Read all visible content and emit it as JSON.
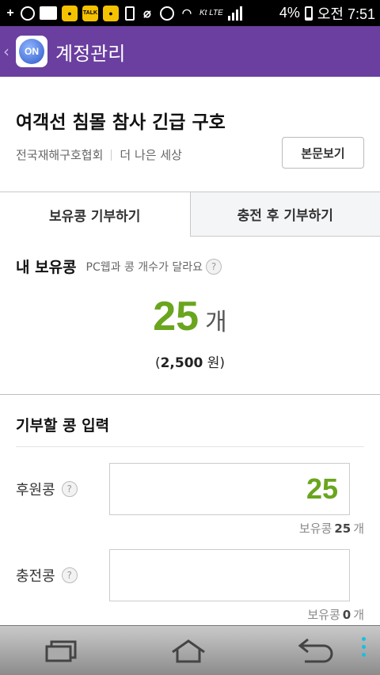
{
  "statusbar": {
    "battery": "4%",
    "time": "오전 7:51",
    "carrier": "Kt LTE",
    "icons": [
      "plus-icon",
      "alarm-icon",
      "gallery-icon",
      "kakao-icon",
      "kakaotalk-icon",
      "kakao-icon",
      "screen-icon",
      "mute-icon",
      "alarm-icon",
      "wifi-icon",
      "signal-icon",
      "battery-icon"
    ]
  },
  "appbar": {
    "logo_text": "ON",
    "title": "계정관리"
  },
  "header": {
    "title": "여객선 침몰 참사 긴급 구호",
    "org": "전국재해구호협회",
    "slogan": "더 나은 세상",
    "view_button": "본문보기"
  },
  "tabs": [
    {
      "label": "보유콩 기부하기",
      "active": true
    },
    {
      "label": "충전 후 기부하기",
      "active": false
    }
  ],
  "my_beans": {
    "title": "내 보유콩",
    "note": "PC웹과 콩 개수가 달라요",
    "help": "?",
    "count": "25",
    "unit": "개",
    "won_open": "(",
    "won_amount": "2,500",
    "won_unit": "원)"
  },
  "donate_input": {
    "title": "기부할 콩 입력",
    "rows": [
      {
        "label": "후원콩",
        "help": "?",
        "value": "25",
        "hint_prefix": "보유콩",
        "hint_count": "25",
        "hint_unit": "개"
      },
      {
        "label": "충전콩",
        "help": "?",
        "value": "",
        "hint_prefix": "보유콩",
        "hint_count": "0",
        "hint_unit": "개"
      }
    ]
  },
  "navbar": {
    "accent": "#17c0e0",
    "buttons": [
      "recent-apps-icon",
      "home-icon",
      "back-icon",
      "menu-icon"
    ]
  }
}
